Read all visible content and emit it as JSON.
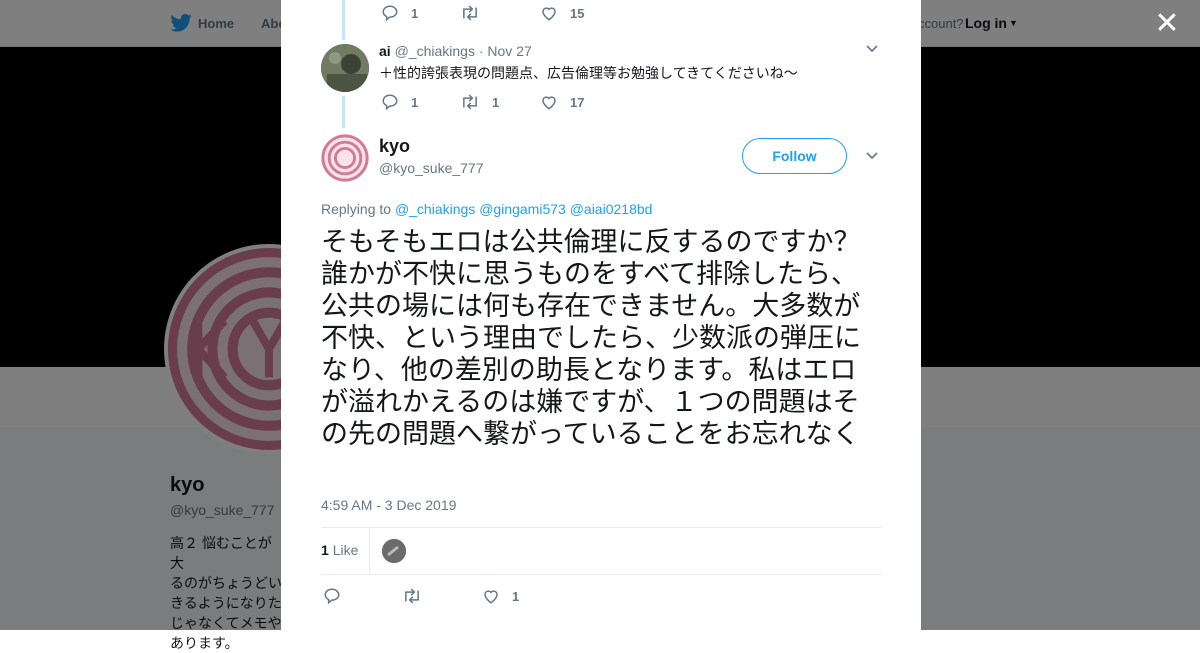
{
  "bg": {
    "nav": {
      "home": "Home",
      "about": "Abo",
      "account_prompt": "ccount?",
      "login": "Log in"
    },
    "profile_name": "kyo",
    "profile_handle": "@kyo_suke_777",
    "bio": "高２ 悩むことが大\nるのがちょうどい\nきるようになりた\nじゃなくてメモや\nあります。"
  },
  "modal": {
    "prev_actions": {
      "replies": "1",
      "retweets": "",
      "likes": "15"
    },
    "ai_tweet": {
      "name": "ai",
      "handle": "@_chiakings",
      "sep": "·",
      "date": "Nov 27",
      "text": "＋性的誇張表現の問題点、広告倫理等お勉強してきてくださいね〜",
      "replies": "1",
      "retweets": "1",
      "likes": "17"
    },
    "main": {
      "name": "kyo",
      "handle": "@kyo_suke_777",
      "follow_label": "Follow",
      "replying_prefix": "Replying to",
      "replying_to": [
        "@_chiakings",
        "@gingami573",
        "@aiai0218bd"
      ],
      "text": "そもそもエロは公共倫理に反するのですか？誰かが不快に思うものをすべて排除したら、公共の場には何も存在できません。大多数が不快、という理由でしたら、少数派の弾圧になり、他の差別の助長となります。私はエロが溢れかえるのは嫌ですが、１つの問題はその先の問題へ繋がっていることをお忘れなく",
      "timestamp": "4:59 AM - 3 Dec 2019",
      "like_count": "1",
      "like_label": "Like",
      "footer": {
        "replies": "",
        "retweets": "",
        "likes": "1"
      }
    }
  },
  "colors": {
    "accent": "#1da1f2",
    "thread": "#c4e4f8",
    "muted": "#657786"
  }
}
